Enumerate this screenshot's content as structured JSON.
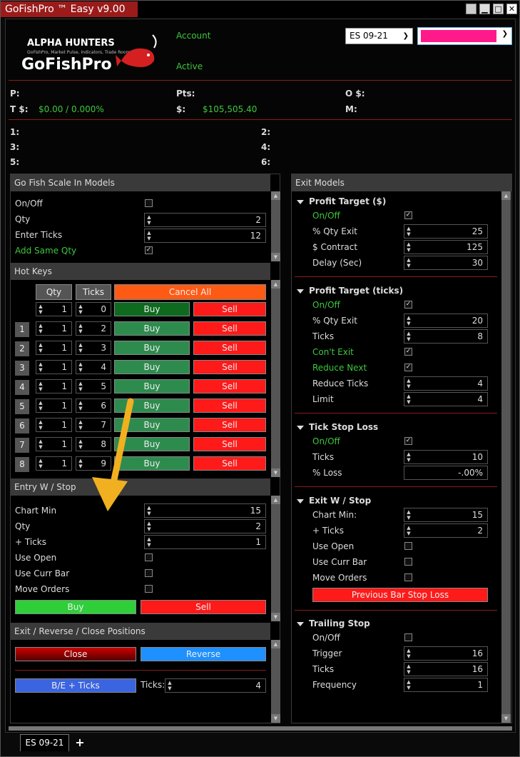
{
  "window": {
    "title": "GoFishPro ™ Easy v9.00 ©"
  },
  "header": {
    "logo_brand": "ALPHA HUNTERS",
    "logo_tagline": "GoFishPro, Market Pulse, Indicators, Trade Room",
    "logo_product": "GoFishPro",
    "account_label": "Account",
    "status_label": "Active",
    "instrument": "ES 09-21",
    "account_color": "#ff1a8c"
  },
  "stats": {
    "p_label": "P:",
    "pts_label": "Pts:",
    "o_label": "O $:",
    "t_label": "T $:",
    "t_value": "$0.00 / 0.000%",
    "dollar_label": "$:",
    "dollar_value": "$105,505.40",
    "m_label": "M:"
  },
  "slots": [
    "1:",
    "2:",
    "3:",
    "4:",
    "5:",
    "6:"
  ],
  "scale_in": {
    "title": "Go Fish Scale In Models",
    "onoff": "On/Off",
    "qty": "Qty",
    "qty_value": "2",
    "enter_ticks": "Enter Ticks",
    "enter_ticks_value": "12",
    "add_same_qty": "Add Same Qty"
  },
  "hotkeys": {
    "title": "Hot Keys",
    "qty_header": "Qty",
    "ticks_header": "Ticks",
    "cancel_all": "Cancel All",
    "buy": "Buy",
    "sell": "Sell",
    "rows": [
      {
        "num": "",
        "qty": "1",
        "ticks": "0"
      },
      {
        "num": "1",
        "qty": "1",
        "ticks": "2"
      },
      {
        "num": "2",
        "qty": "1",
        "ticks": "3"
      },
      {
        "num": "3",
        "qty": "1",
        "ticks": "4"
      },
      {
        "num": "4",
        "qty": "1",
        "ticks": "5"
      },
      {
        "num": "5",
        "qty": "1",
        "ticks": "6"
      },
      {
        "num": "6",
        "qty": "1",
        "ticks": "7"
      },
      {
        "num": "7",
        "qty": "1",
        "ticks": "8"
      },
      {
        "num": "8",
        "qty": "1",
        "ticks": "9"
      }
    ]
  },
  "entry_stop": {
    "title": "Entry W / Stop",
    "chart_min": "Chart Min",
    "chart_min_value": "15",
    "qty": "Qty",
    "qty_value": "2",
    "plus_ticks": "+ Ticks",
    "plus_ticks_value": "1",
    "use_open": "Use Open",
    "use_curr_bar": "Use Curr Bar",
    "move_orders": "Move Orders",
    "buy": "Buy",
    "sell": "Sell"
  },
  "exit_reverse": {
    "title": "Exit / Reverse / Close Positions",
    "close": "Close",
    "reverse": "Reverse",
    "be_ticks": "B/E + Ticks",
    "ticks_label": "Ticks:",
    "ticks_value": "4"
  },
  "exit_models": {
    "title": "Exit Models",
    "profit_dollar": {
      "title": "Profit Target ($)",
      "onoff": "On/Off",
      "qty_exit": "% Qty Exit",
      "qty_exit_value": "25",
      "contract": "$ Contract",
      "contract_value": "125",
      "delay": "Delay (Sec)",
      "delay_value": "30"
    },
    "profit_ticks": {
      "title": "Profit Target (ticks)",
      "onoff": "On/Off",
      "qty_exit": "% Qty Exit",
      "qty_exit_value": "20",
      "ticks": "Ticks",
      "ticks_value": "8",
      "cont_exit": "Con't Exit",
      "reduce_next": "Reduce Next",
      "reduce_ticks": "Reduce Ticks",
      "reduce_ticks_value": "4",
      "limit": "Limit",
      "limit_value": "4"
    },
    "tick_stop": {
      "title": "Tick Stop Loss",
      "onoff": "On/Off",
      "ticks": "Ticks",
      "ticks_value": "10",
      "loss": "% Loss",
      "loss_value": "-.00%"
    },
    "exit_stop": {
      "title": "Exit W / Stop",
      "chart_min": "Chart Min:",
      "chart_min_value": "15",
      "plus_ticks": "+ Ticks",
      "plus_ticks_value": "2",
      "use_open": "Use Open",
      "use_curr_bar": "Use Curr Bar",
      "move_orders": "Move Orders",
      "prev_bar": "Previous Bar Stop Loss"
    },
    "trailing": {
      "title": "Trailing Stop",
      "onoff": "On/Off",
      "trigger": "Trigger",
      "trigger_value": "16",
      "ticks": "Ticks",
      "ticks_value": "16",
      "frequency": "Frequency",
      "frequency_value": "1"
    }
  },
  "tabs": {
    "active": "ES 09-21",
    "add": "+"
  }
}
